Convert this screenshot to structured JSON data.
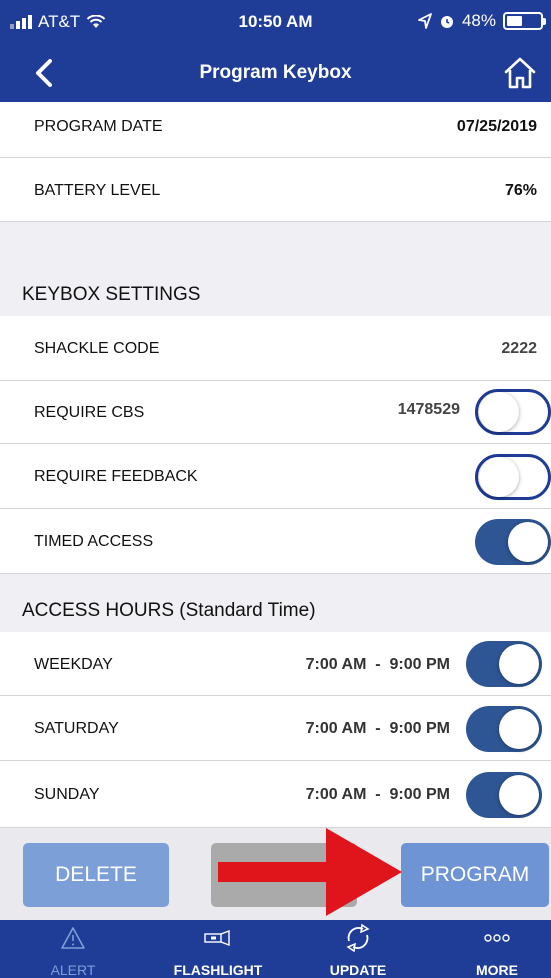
{
  "status_bar": {
    "carrier": "AT&T",
    "time": "10:50 AM",
    "battery_percent": "48%",
    "battery_level": 0.48
  },
  "nav": {
    "title": "Program Keybox",
    "back_icon": "chevron-left-icon",
    "home_icon": "home-icon"
  },
  "info": {
    "program_date_label": "PROGRAM DATE",
    "program_date_value": "07/25/2019",
    "battery_label": "BATTERY LEVEL",
    "battery_value": "76%"
  },
  "keybox_settings": {
    "header": "KEYBOX SETTINGS",
    "shackle_label": "SHACKLE CODE",
    "shackle_value": "2222",
    "require_cbs_label": "REQUIRE CBS",
    "require_cbs_value": "1478529",
    "require_cbs_on": false,
    "require_feedback_label": "REQUIRE FEEDBACK",
    "require_feedback_on": false,
    "timed_access_label": "TIMED ACCESS",
    "timed_access_on": true
  },
  "access_hours": {
    "header": "ACCESS HOURS (Standard Time)",
    "rows": [
      {
        "label": "WEEKDAY",
        "hours": "7:00 AM  -  9:00 PM",
        "on": true
      },
      {
        "label": "SATURDAY",
        "hours": "7:00 AM  -  9:00 PM",
        "on": true
      },
      {
        "label": "SUNDAY",
        "hours": "7:00 AM  -  9:00 PM",
        "on": true
      }
    ]
  },
  "buttons": {
    "delete": "DELETE",
    "read": "READ",
    "program": "PROGRAM"
  },
  "tabs": [
    {
      "label": "ALERT",
      "icon": "alert-triangle-icon"
    },
    {
      "label": "FLASHLIGHT",
      "icon": "flashlight-icon"
    },
    {
      "label": "UPDATE",
      "icon": "sync-icon"
    },
    {
      "label": "MORE",
      "icon": "more-dots-icon"
    }
  ],
  "colors": {
    "brand": "#1f3c96",
    "toggle_on": "#2e5694",
    "arrow": "#e0141b"
  }
}
